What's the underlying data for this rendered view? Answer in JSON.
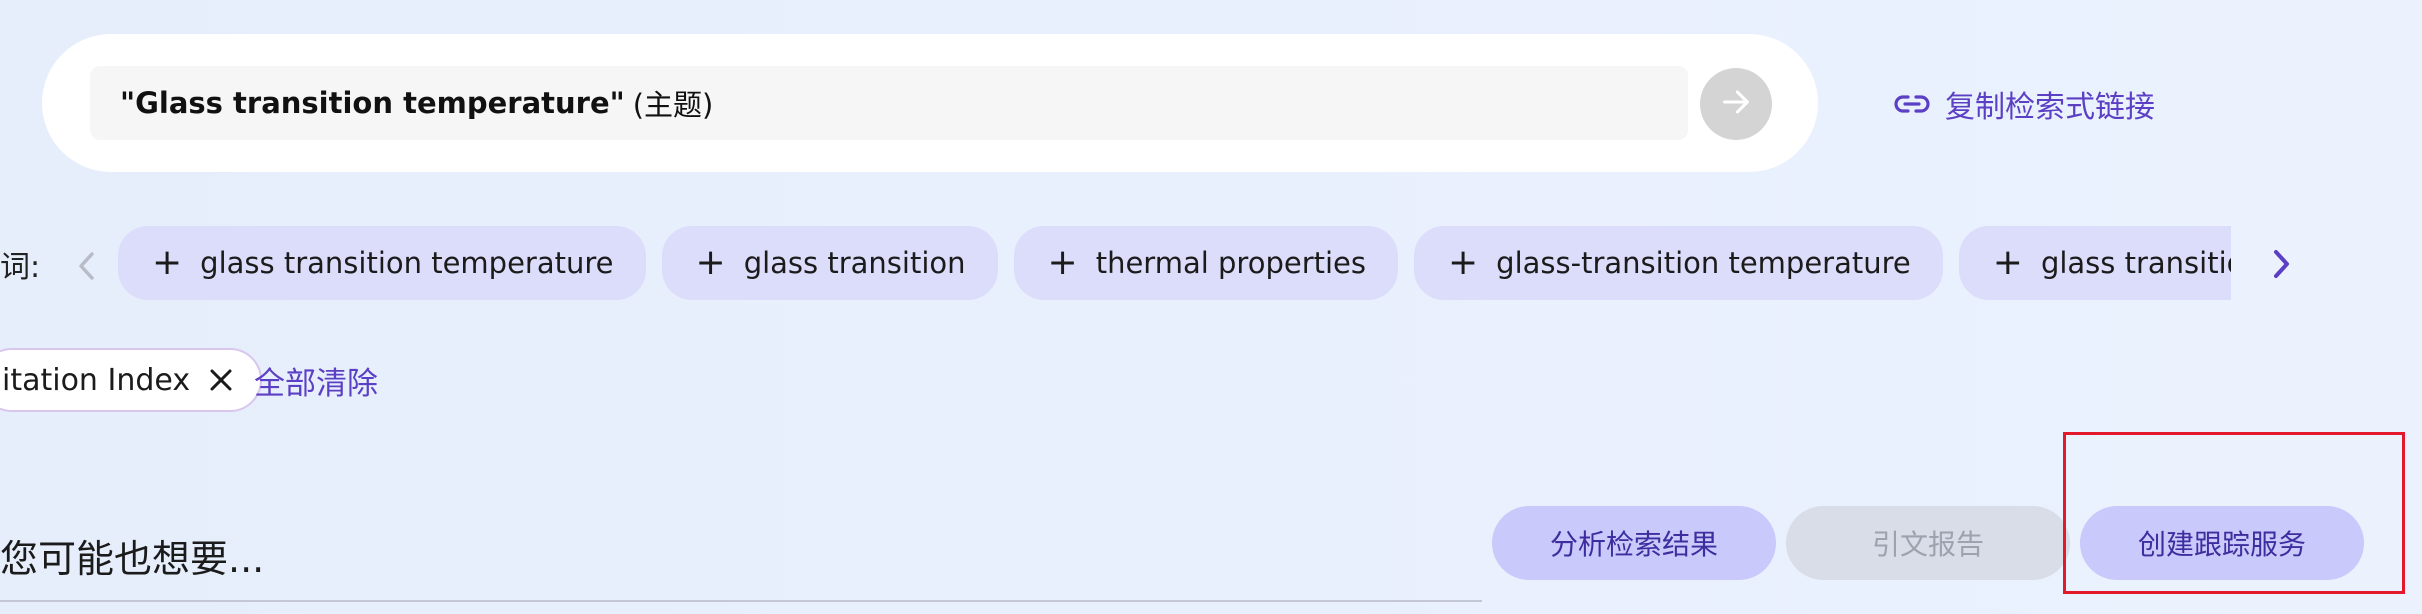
{
  "search": {
    "query_term": "\"Glass transition temperature\"",
    "query_field": "(主题)",
    "copy_link_label": "复制检索式链接"
  },
  "related_terms": {
    "label": "词:",
    "chips": [
      {
        "label": "glass transition temperature"
      },
      {
        "label": "glass transition"
      },
      {
        "label": "thermal properties"
      },
      {
        "label": "glass-transition temperature"
      },
      {
        "label": "glass transition temp"
      }
    ]
  },
  "filters": {
    "active_filter_label": "itation Index",
    "clear_all_label": "全部清除"
  },
  "suggestions": {
    "heading": "您可能也想要..."
  },
  "actions": {
    "analyze_label": "分析检索结果",
    "citation_report_label": "引文报告",
    "create_alert_label": "创建跟踪服务"
  },
  "colors": {
    "accent": "#5b3fc4",
    "chip_bg": "#dcdcfb",
    "button_bg": "#c9c9fb",
    "disabled_bg": "#d8dde8",
    "highlight": "#e3192b"
  },
  "icons": {
    "submit": "arrow-right-icon",
    "copy_link": "link-icon",
    "prev": "chevron-left-icon",
    "next": "chevron-right-icon",
    "chip_add": "plus-icon",
    "remove_filter": "close-icon"
  }
}
